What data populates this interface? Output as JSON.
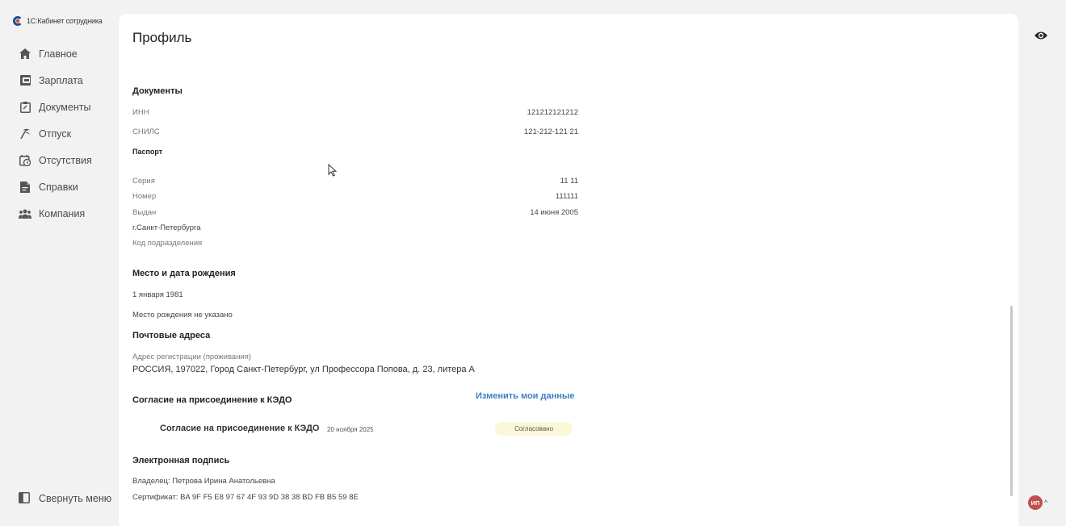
{
  "app": {
    "brand": "1С:Кабинет сотрудника"
  },
  "sidebar": {
    "items": [
      {
        "label": "Главное",
        "icon": "home-icon"
      },
      {
        "label": "Зарплата",
        "icon": "wallet-icon"
      },
      {
        "label": "Документы",
        "icon": "clipboard-icon"
      },
      {
        "label": "Отпуск",
        "icon": "palm-icon"
      },
      {
        "label": "Отсутствия",
        "icon": "calendar-clock-icon"
      },
      {
        "label": "Справки",
        "icon": "file-icon"
      },
      {
        "label": "Компания",
        "icon": "people-icon"
      }
    ],
    "collapse_label": "Свернуть меню"
  },
  "page": {
    "title": "Профиль"
  },
  "documents": {
    "heading": "Документы",
    "inn_label": "ИНН",
    "inn_value": "121212121212",
    "snils_label": "СНИЛС",
    "snils_value": "121-212-121 21",
    "passport_heading": "Паспорт",
    "series_label": "Серия",
    "series_value": "11 11",
    "number_label": "Номер",
    "number_value": "111111",
    "issued_label": "Выдан",
    "issued_value": "14 июня 2005",
    "issued_place": "г.Санкт-Петербурга",
    "division_code_label": "Код подразделения"
  },
  "birth": {
    "heading": "Место и дата рождения",
    "date": "1 января 1981",
    "place": "Место рождения не указано"
  },
  "postal": {
    "heading": "Почтовые адреса",
    "reg_label": "Адрес регистрации (проживания)",
    "reg_value": "РОССИЯ, 197022, Город Санкт-Петербург, ул Профессора Попова, д. 23, литера А"
  },
  "consent": {
    "heading": "Согласие на присоединение к КЭДО",
    "edit_link": "Изменить мои данные",
    "row_title": "Согласие на присоединение к КЭДО",
    "row_date": "20 ноября 2025",
    "row_status": "Согласовано"
  },
  "signature": {
    "heading": "Электронная подпись",
    "owner": "Владелец: Петрова Ирина Анатольевна",
    "certificate": "Сертификат: BA 9F F5 E8 97 67 4F 93 9D 38 38 BD FB B5 59 8E"
  },
  "user": {
    "initials": "ИП",
    "chevron": "^"
  },
  "colors": {
    "accent": "#3d7fc4",
    "badge_bg": "#fbf8d9",
    "avatar": "#c0504d"
  }
}
